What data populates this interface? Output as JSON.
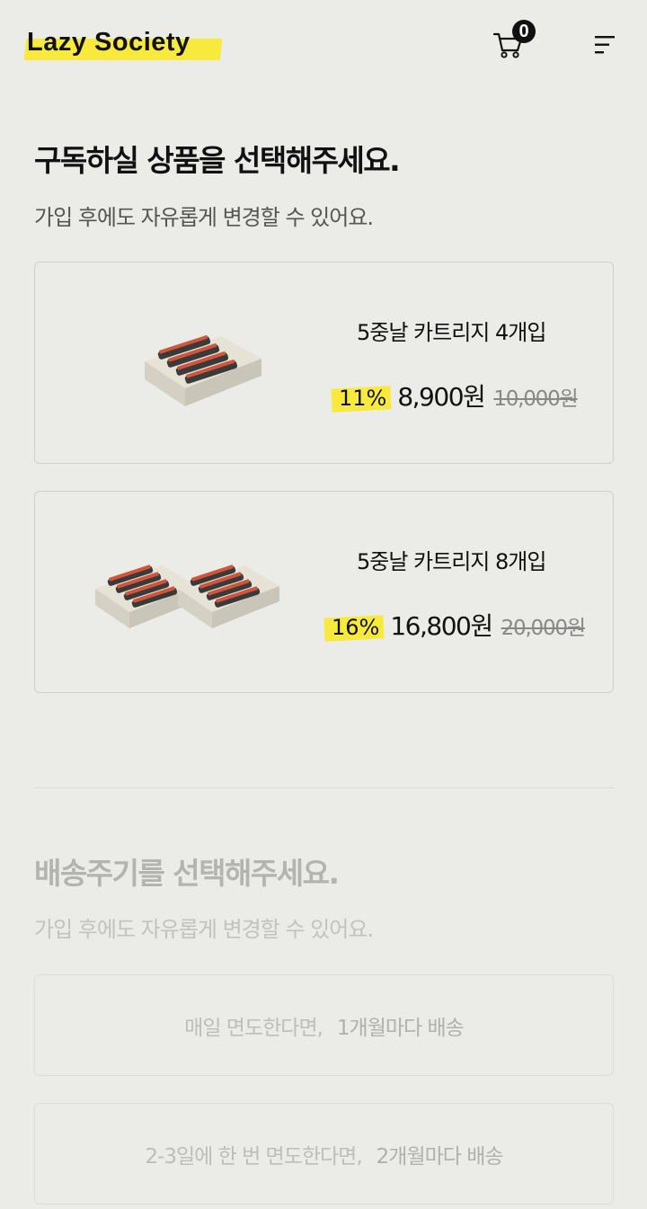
{
  "header": {
    "logo": "Lazy Society",
    "cart_count": "0",
    "icons": {
      "cart": "cart-icon",
      "menu": "menu-icon"
    }
  },
  "products_section": {
    "title": "구독하실 상품을 선택해주세요.",
    "subtitle": "가입 후에도 자유롭게 변경할 수 있어요.",
    "items": [
      {
        "name": "5중날 카트리지 4개입",
        "discount": "11%",
        "price": "8,900원",
        "original_price": "10,000원"
      },
      {
        "name": "5중날 카트리지 8개입",
        "discount": "16%",
        "price": "16,800원",
        "original_price": "20,000원"
      }
    ]
  },
  "delivery_section": {
    "title": "배송주기를 선택해주세요.",
    "subtitle": "가입 후에도 자유롭게 변경할 수 있어요.",
    "options": [
      {
        "condition": "매일 면도한다면,",
        "cycle": "1개월마다 배송"
      },
      {
        "condition": "2-3일에 한 번 면도한다면,",
        "cycle": "2개월마다 배송"
      }
    ]
  },
  "colors": {
    "background": "#ebebe7",
    "highlight": "#f7ea3c",
    "text": "#111111"
  }
}
